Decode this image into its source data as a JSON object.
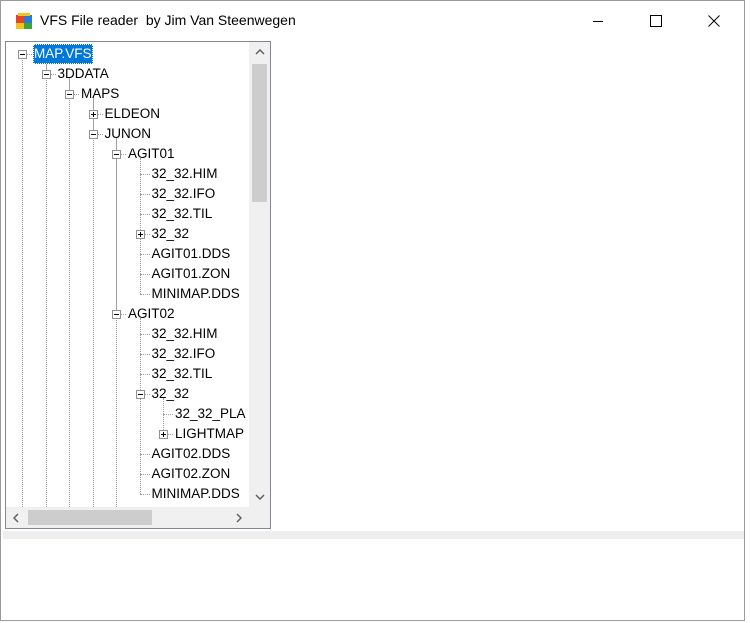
{
  "window": {
    "title": "VFS File reader  by Jim Van Steenwegen",
    "controls": [
      {
        "name": "minimize",
        "glyph": "—"
      },
      {
        "name": "maximize",
        "glyph": "☐"
      },
      {
        "name": "close",
        "glyph": "✕"
      }
    ]
  },
  "tree": {
    "selected": "MAP.VFS",
    "nodes": [
      {
        "label": "MAP.VFS",
        "level": 0,
        "toggle": "minus"
      },
      {
        "label": "3DDATA",
        "level": 1,
        "toggle": "minus"
      },
      {
        "label": "MAPS",
        "level": 2,
        "toggle": "minus"
      },
      {
        "label": "ELDEON",
        "level": 3,
        "toggle": "plus"
      },
      {
        "label": "JUNON",
        "level": 3,
        "toggle": "minus"
      },
      {
        "label": "AGIT01",
        "level": 4,
        "toggle": "minus"
      },
      {
        "label": "32_32.HIM",
        "level": 5,
        "toggle": null
      },
      {
        "label": "32_32.IFO",
        "level": 5,
        "toggle": null
      },
      {
        "label": "32_32.TIL",
        "level": 5,
        "toggle": null
      },
      {
        "label": "32_32",
        "level": 5,
        "toggle": "plus"
      },
      {
        "label": "AGIT01.DDS",
        "level": 5,
        "toggle": null
      },
      {
        "label": "AGIT01.ZON",
        "level": 5,
        "toggle": null
      },
      {
        "label": "MINIMAP.DDS",
        "level": 5,
        "toggle": null
      },
      {
        "label": "AGIT02",
        "level": 4,
        "toggle": "minus"
      },
      {
        "label": "32_32.HIM",
        "level": 5,
        "toggle": null
      },
      {
        "label": "32_32.IFO",
        "level": 5,
        "toggle": null
      },
      {
        "label": "32_32.TIL",
        "level": 5,
        "toggle": null
      },
      {
        "label": "32_32",
        "level": 5,
        "toggle": "minus"
      },
      {
        "label": "32_32_PLA",
        "level": 6,
        "toggle": null
      },
      {
        "label": "LIGHTMAP",
        "level": 6,
        "toggle": "plus"
      },
      {
        "label": "AGIT02.DDS",
        "level": 5,
        "toggle": null
      },
      {
        "label": "AGIT02.ZON",
        "level": 5,
        "toggle": null
      },
      {
        "label": "MINIMAP.DDS",
        "level": 5,
        "toggle": null
      }
    ]
  },
  "scrollbars": {
    "vertical": {
      "up": "up-arrow-icon",
      "down": "down-arrow-icon",
      "position": 0.0
    },
    "horizontal": {
      "left": "left-arrow-icon",
      "right": "right-arrow-icon",
      "position": 0.0
    }
  },
  "colors": {
    "selection": "#0078d7",
    "scroll_track": "#f0f0f0",
    "scroll_thumb": "#cdcdcd",
    "border": "#828790"
  }
}
